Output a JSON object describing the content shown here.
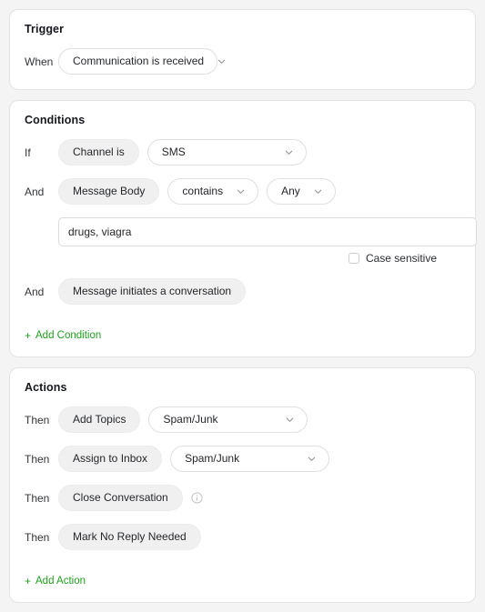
{
  "theme": {
    "background": "#f4f4f4",
    "card_background": "#ffffff",
    "accent_green": "#20a020",
    "pill_background": "#f0f0f0",
    "text": "#25272b"
  },
  "trigger": {
    "title": "Trigger",
    "row": {
      "conjunction": "When",
      "select_value": "Communication is received"
    }
  },
  "conditions": {
    "title": "Conditions",
    "rows": [
      {
        "conjunction": "If",
        "field": "Channel is",
        "select_value": "SMS"
      },
      {
        "conjunction": "And",
        "field": "Message Body",
        "operator": "contains",
        "match": "Any"
      },
      {
        "conjunction": "And",
        "field": "Message initiates a conversation"
      }
    ],
    "keywords_input": {
      "value": "drugs, viagra",
      "placeholder": ""
    },
    "case_sensitive": {
      "label": "Case sensitive",
      "checked": false
    },
    "add_link": {
      "plus": "+",
      "label": "Add Condition"
    }
  },
  "actions": {
    "title": "Actions",
    "rows": [
      {
        "conjunction": "Then",
        "action": "Add Topics",
        "select_value": "Spam/Junk"
      },
      {
        "conjunction": "Then",
        "action": "Assign to Inbox",
        "select_value": "Spam/Junk"
      },
      {
        "conjunction": "Then",
        "action": "Close Conversation",
        "info_icon": "info-icon"
      },
      {
        "conjunction": "Then",
        "action": "Mark No Reply Needed"
      }
    ],
    "add_link": {
      "plus": "+",
      "label": "Add Action"
    }
  },
  "icons": {
    "chevron_down": "chevron-down-icon",
    "info": "info-icon"
  }
}
